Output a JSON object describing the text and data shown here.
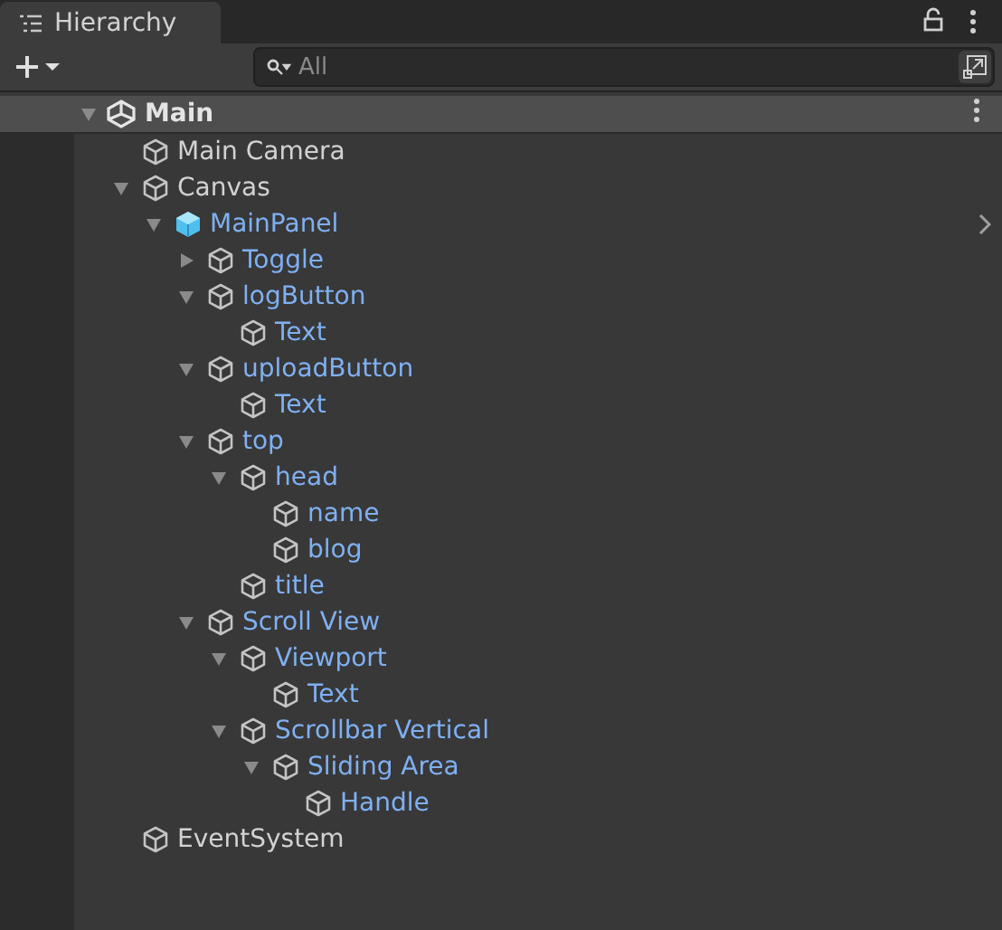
{
  "tab": {
    "title": "Hierarchy",
    "selected": true
  },
  "search": {
    "placeholder": "All"
  },
  "scene": {
    "name": "Main",
    "expanded": true,
    "children": [
      {
        "name": "Main Camera",
        "kind": "gameobject"
      },
      {
        "name": "Canvas",
        "kind": "gameobject",
        "expanded": true,
        "children": [
          {
            "name": "MainPanel",
            "kind": "prefab_root",
            "expanded": true,
            "children": [
              {
                "name": "Toggle",
                "kind": "prefab",
                "expanded": false
              },
              {
                "name": "logButton",
                "kind": "prefab",
                "expanded": true,
                "children": [
                  {
                    "name": "Text",
                    "kind": "prefab"
                  }
                ]
              },
              {
                "name": "uploadButton",
                "kind": "prefab",
                "expanded": true,
                "children": [
                  {
                    "name": "Text",
                    "kind": "prefab"
                  }
                ]
              },
              {
                "name": "top",
                "kind": "prefab",
                "expanded": true,
                "children": [
                  {
                    "name": "head",
                    "kind": "prefab",
                    "expanded": true,
                    "children": [
                      {
                        "name": "name",
                        "kind": "prefab"
                      },
                      {
                        "name": "blog",
                        "kind": "prefab"
                      }
                    ]
                  },
                  {
                    "name": "title",
                    "kind": "prefab"
                  }
                ]
              },
              {
                "name": "Scroll View",
                "kind": "prefab",
                "expanded": true,
                "children": [
                  {
                    "name": "Viewport",
                    "kind": "prefab",
                    "expanded": true,
                    "children": [
                      {
                        "name": "Text",
                        "kind": "prefab"
                      }
                    ]
                  },
                  {
                    "name": "Scrollbar Vertical",
                    "kind": "prefab",
                    "expanded": true,
                    "children": [
                      {
                        "name": "Sliding Area",
                        "kind": "prefab",
                        "expanded": true,
                        "children": [
                          {
                            "name": "Handle",
                            "kind": "prefab"
                          }
                        ]
                      }
                    ]
                  }
                ]
              }
            ]
          }
        ]
      },
      {
        "name": "EventSystem",
        "kind": "gameobject"
      }
    ]
  }
}
